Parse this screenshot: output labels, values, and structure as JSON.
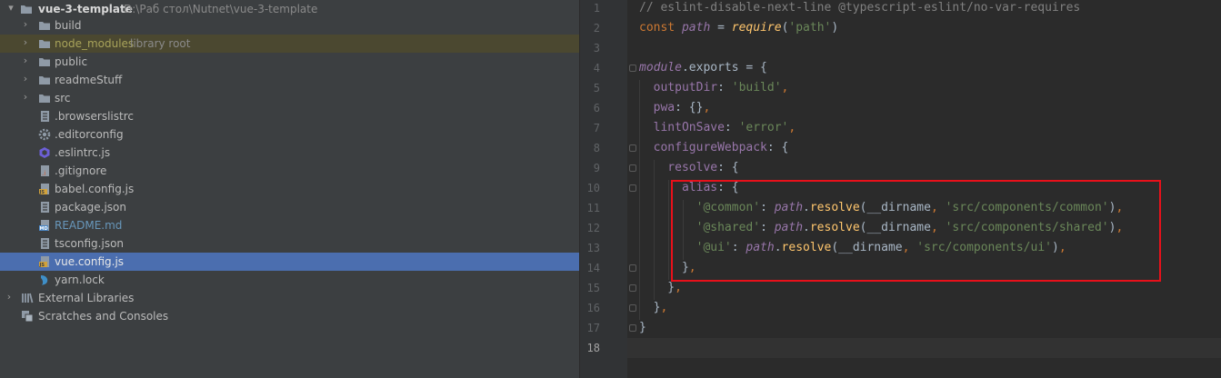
{
  "project": {
    "root_name": "vue-3-template",
    "root_path": "D:\\Раб стол\\Nutnet\\vue-3-template",
    "items": [
      {
        "label": "build",
        "icon": "folder-icon"
      },
      {
        "label": "node_modules",
        "hint": "library root",
        "icon": "folder-icon"
      },
      {
        "label": "public",
        "icon": "folder-icon"
      },
      {
        "label": "readmeStuff",
        "icon": "folder-icon"
      },
      {
        "label": "src",
        "icon": "folder-icon"
      },
      {
        "label": ".browserslistrc",
        "icon": "text-file-icon"
      },
      {
        "label": ".editorconfig",
        "icon": "gear-icon"
      },
      {
        "label": ".eslintrc.js",
        "icon": "eslint-icon"
      },
      {
        "label": ".gitignore",
        "icon": "gitignore-file-icon"
      },
      {
        "label": "babel.config.js",
        "icon": "js-file-icon"
      },
      {
        "label": "package.json",
        "icon": "json-file-icon"
      },
      {
        "label": "README.md",
        "icon": "markdown-file-icon"
      },
      {
        "label": "tsconfig.json",
        "icon": "json-file-icon"
      },
      {
        "label": "vue.config.js",
        "icon": "js-file-icon",
        "selected": true
      },
      {
        "label": "yarn.lock",
        "icon": "yarn-icon"
      }
    ],
    "external_libraries": "External Libraries",
    "scratches": "Scratches and Consoles"
  },
  "editor": {
    "line_numbers": [
      "1",
      "2",
      "3",
      "4",
      "5",
      "6",
      "7",
      "8",
      "9",
      "10",
      "11",
      "12",
      "13",
      "14",
      "15",
      "16",
      "17",
      "18"
    ],
    "current_line": "18",
    "lines": [
      [
        {
          "t": "// eslint-disable-next-line @typescript-eslint/no-var-requires",
          "c": "cmt"
        }
      ],
      [
        {
          "t": "const ",
          "c": "kw"
        },
        {
          "t": "path",
          "c": "vi"
        },
        {
          "t": " = ",
          "c": "df"
        },
        {
          "t": "require",
          "c": "fi"
        },
        {
          "t": "(",
          "c": "df"
        },
        {
          "t": "'path'",
          "c": "st"
        },
        {
          "t": ")",
          "c": "df"
        }
      ],
      [],
      [
        {
          "t": "module",
          "c": "vi"
        },
        {
          "t": ".exports = {",
          "c": "df"
        }
      ],
      [
        {
          "t": "  outputDir",
          "c": "pr"
        },
        {
          "t": ": ",
          "c": "df"
        },
        {
          "t": "'build'",
          "c": "st"
        },
        {
          "t": ",",
          "c": "kw"
        }
      ],
      [
        {
          "t": "  pwa",
          "c": "pr"
        },
        {
          "t": ": {}",
          "c": "df"
        },
        {
          "t": ",",
          "c": "kw"
        }
      ],
      [
        {
          "t": "  lintOnSave",
          "c": "pr"
        },
        {
          "t": ": ",
          "c": "df"
        },
        {
          "t": "'error'",
          "c": "st"
        },
        {
          "t": ",",
          "c": "kw"
        }
      ],
      [
        {
          "t": "  configureWebpack",
          "c": "pr"
        },
        {
          "t": ": {",
          "c": "df"
        }
      ],
      [
        {
          "t": "    resolve",
          "c": "pr"
        },
        {
          "t": ": {",
          "c": "df"
        }
      ],
      [
        {
          "t": "      alias",
          "c": "pr"
        },
        {
          "t": ": {",
          "c": "df"
        }
      ],
      [
        {
          "t": "        '@common'",
          "c": "st"
        },
        {
          "t": ": ",
          "c": "df"
        },
        {
          "t": "path",
          "c": "vi"
        },
        {
          "t": ".",
          "c": "df"
        },
        {
          "t": "resolve",
          "c": "fn"
        },
        {
          "t": "(__dirname",
          "c": "df"
        },
        {
          "t": ", ",
          "c": "kw"
        },
        {
          "t": "'src/components/common'",
          "c": "st"
        },
        {
          "t": ")",
          "c": "df"
        },
        {
          "t": ",",
          "c": "kw"
        }
      ],
      [
        {
          "t": "        '@shared'",
          "c": "st"
        },
        {
          "t": ": ",
          "c": "df"
        },
        {
          "t": "path",
          "c": "vi"
        },
        {
          "t": ".",
          "c": "df"
        },
        {
          "t": "resolve",
          "c": "fn"
        },
        {
          "t": "(__dirname",
          "c": "df"
        },
        {
          "t": ", ",
          "c": "kw"
        },
        {
          "t": "'src/components/shared'",
          "c": "st"
        },
        {
          "t": ")",
          "c": "df"
        },
        {
          "t": ",",
          "c": "kw"
        }
      ],
      [
        {
          "t": "        '@ui'",
          "c": "st"
        },
        {
          "t": ": ",
          "c": "df"
        },
        {
          "t": "path",
          "c": "vi"
        },
        {
          "t": ".",
          "c": "df"
        },
        {
          "t": "resolve",
          "c": "fn"
        },
        {
          "t": "(__dirname",
          "c": "df"
        },
        {
          "t": ", ",
          "c": "kw"
        },
        {
          "t": "'src/components/ui'",
          "c": "st"
        },
        {
          "t": ")",
          "c": "df"
        },
        {
          "t": ",",
          "c": "kw"
        }
      ],
      [
        {
          "t": "      }",
          "c": "df"
        },
        {
          "t": ",",
          "c": "kw"
        }
      ],
      [
        {
          "t": "    }",
          "c": "df"
        },
        {
          "t": ",",
          "c": "kw"
        }
      ],
      [
        {
          "t": "  }",
          "c": "df"
        },
        {
          "t": ",",
          "c": "kw"
        }
      ],
      [
        {
          "t": "}",
          "c": "df"
        }
      ],
      []
    ]
  },
  "colors": {
    "highlight_box": "#e8101a",
    "selection": "#4b6eaf"
  }
}
